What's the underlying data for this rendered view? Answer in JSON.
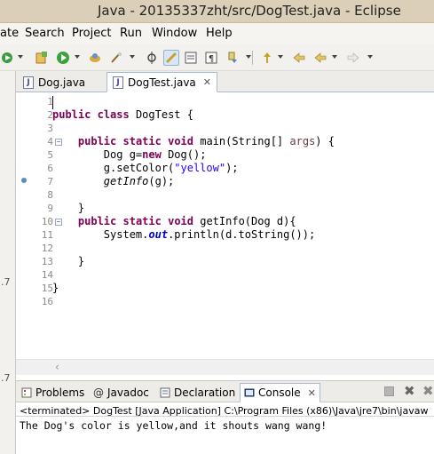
{
  "window": {
    "title": "Java - 20135337zht/src/DogTest.java - Eclipse"
  },
  "menu": {
    "items": [
      "ate",
      "Search",
      "Project",
      "Run",
      "Window",
      "Help"
    ]
  },
  "toolbar": {
    "icons": [
      "debug-icon",
      "new-icon",
      "run-icon",
      "open-type-icon",
      "search-icon",
      "next-annotation-icon",
      "mark-occurrences-icon",
      "block-selection-icon",
      "show-whitespace-icon",
      "pin-icon",
      "back-icon",
      "forward-icon"
    ]
  },
  "left_strip": {
    "fragments": [
      ".7",
      ".7"
    ]
  },
  "editor_tabs": [
    {
      "label": "Dog.java",
      "active": false
    },
    {
      "label": "DogTest.java",
      "active": true,
      "close": "✕"
    }
  ],
  "editor": {
    "line_numbers": [
      "1",
      "2",
      "3",
      "4",
      "5",
      "6",
      "7",
      "8",
      "9",
      "10",
      "11",
      "12",
      "13",
      "14",
      "15",
      "16"
    ],
    "fold_markers": {
      "4": "−",
      "10": "−"
    },
    "code": {
      "l2_kw1": "public",
      "l2_kw2": "class",
      "l2_name": "DogTest {",
      "l4_kw1": "public",
      "l4_kw2": "static",
      "l4_kw3": "void",
      "l4_sig": "main(String[]",
      "l4_param": "args",
      "l4_end": ") {",
      "l5_a": "Dog g=",
      "l5_kw": "new",
      "l5_b": "Dog();",
      "l6_a": "g.setColor(",
      "l6_str": "\"yellow\"",
      "l6_b": ");",
      "l7_call": "getInfo",
      "l7_b": "(g);",
      "l9": "}",
      "l10_kw1": "public",
      "l10_kw2": "static",
      "l10_kw3": "void",
      "l10_sig": "getInfo(Dog d){",
      "l11_a": "System.",
      "l11_out": "out",
      "l11_b": ".println(d.toString());",
      "l13": "}",
      "l15": "}"
    }
  },
  "bottom_tabs": [
    {
      "label": "Problems",
      "active": false
    },
    {
      "label": "Javadoc",
      "active": false
    },
    {
      "label": "Declaration",
      "active": false
    },
    {
      "label": "Console",
      "active": true,
      "close": "✕"
    }
  ],
  "console": {
    "status": "<terminated> DogTest [Java Application] C:\\Program Files (x86)\\Java\\jre7\\bin\\javaw",
    "output": "The Dog's color is yellow,and it shouts wang wang!"
  },
  "colors": {
    "keyword": "#7f0055",
    "string": "#2a00ff",
    "title_bar": "#dccfb8"
  }
}
